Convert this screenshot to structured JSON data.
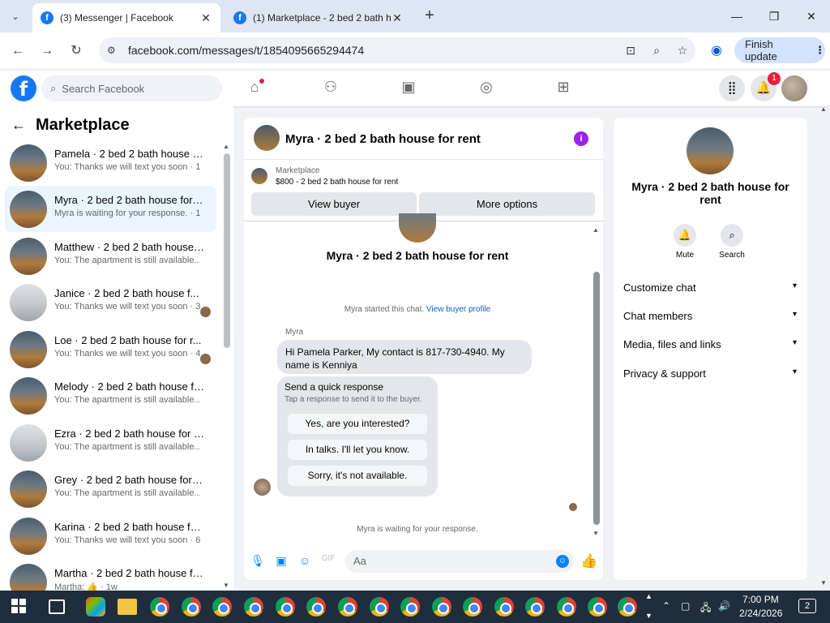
{
  "browser": {
    "tabs": [
      {
        "title": "(3) Messenger | Facebook",
        "active": true
      },
      {
        "title": "(1) Marketplace - 2 bed 2 bath h",
        "active": false
      }
    ],
    "url": "facebook.com/messages/t/1854095665294474",
    "finish_update": "Finish update"
  },
  "fb": {
    "search_placeholder": "Search Facebook",
    "notification_count": "1",
    "brand_color": "#1877f2"
  },
  "left": {
    "title": "Marketplace",
    "conversations": [
      {
        "name": "Pamela · 2 bed 2 bath house for...",
        "sub": "You: Thanks we will text you soon · 1m"
      },
      {
        "name": "Myra · 2 bed 2 bath house for r...",
        "sub": "Myra is waiting for your response. · 12h"
      },
      {
        "name": "Matthew · 2 bed 2 bath house f...",
        "sub": "You: The apartment is still available... · 2d"
      },
      {
        "name": "Janice · 2 bed 2 bath house f...",
        "sub": "You: Thanks we will text you soon · 3d"
      },
      {
        "name": "Loe · 2 bed 2 bath house for r...",
        "sub": "You: Thanks we will text you soon · 4d"
      },
      {
        "name": "Melody · 2 bed 2 bath house fo...",
        "sub": "You: The apartment is still available... · 4d"
      },
      {
        "name": "Ezra · 2 bed 2 bath house for rent",
        "sub": "You: The apartment is still available... · 5d"
      },
      {
        "name": "Grey · 2 bed 2 bath house for re...",
        "sub": "You: The apartment is still available... · 5d"
      },
      {
        "name": "Karina · 2 bed 2 bath house for ...",
        "sub": "You: Thanks we will text you soon · 6d"
      },
      {
        "name": "Martha · 2 bed 2 bath house for...",
        "sub": "Martha: 👍 · 1w"
      }
    ]
  },
  "chat": {
    "title": "Myra · 2 bed 2 bath house for rent",
    "marketplace_label": "Marketplace",
    "listing": "$800 - 2 bed 2 bath house for rent",
    "view_buyer": "View buyer",
    "more_options": "More options",
    "profile_name": "Myra · 2 bed 2 bath house for rent",
    "started_text": "Myra started this chat.",
    "view_profile": "View buyer profile",
    "sender": "Myra",
    "message": "Hi Pamela Parker, My contact is 817-730-4940. My name is Kenniya",
    "quick_title": "Send a quick response",
    "quick_sub": "Tap a response to send it to the buyer.",
    "quick_options": [
      "Yes, are you interested?",
      "In talks. I'll let you know.",
      "Sorry, it's not available."
    ],
    "waiting": "Myra is waiting for your response.",
    "compose_placeholder": "Aa"
  },
  "right": {
    "name": "Myra · 2 bed 2 bath house for rent",
    "mute": "Mute",
    "search": "Search",
    "sections": [
      "Customize chat",
      "Chat members",
      "Media, files and links",
      "Privacy & support"
    ]
  },
  "taskbar": {
    "time": "7:00 PM",
    "date": "2/24/2026",
    "notifications": "2"
  }
}
